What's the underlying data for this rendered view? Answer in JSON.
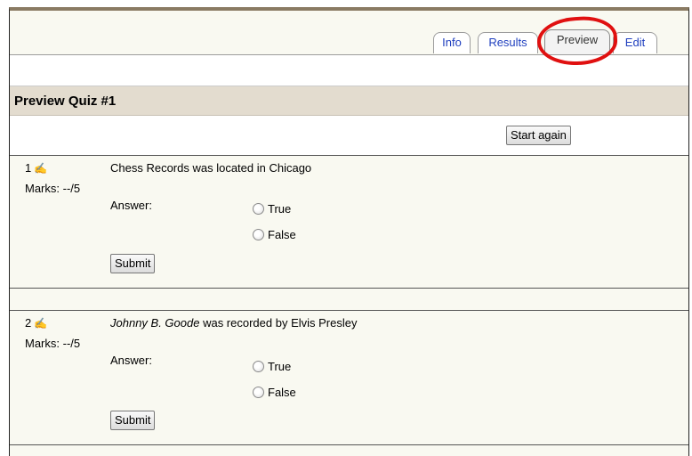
{
  "tabs": [
    {
      "label": "Info"
    },
    {
      "label": "Results"
    },
    {
      "label": "Preview"
    },
    {
      "label": "Edit"
    }
  ],
  "active_tab": "Preview",
  "page_title": "Preview Quiz #1",
  "start_again_label": "Start again",
  "questions": [
    {
      "number": "1",
      "marks": "Marks: --/5",
      "text_italic": "",
      "text": "Chess Records was located in Chicago",
      "answer_label": "Answer:",
      "options": [
        "True",
        "False"
      ],
      "submit_label": "Submit"
    },
    {
      "number": "2",
      "marks": "Marks: --/5",
      "text_italic": "Johnny B. Goode",
      "text": " was recorded by Elvis Presley",
      "answer_label": "Answer:",
      "options": [
        "True",
        "False"
      ],
      "submit_label": "Submit"
    }
  ],
  "icons": {
    "question_edit": "pencil-edit-icon"
  },
  "colors": {
    "header_bg": "#e3dccf",
    "tab_link": "#1f3fbf",
    "highlight": "#e01010"
  }
}
